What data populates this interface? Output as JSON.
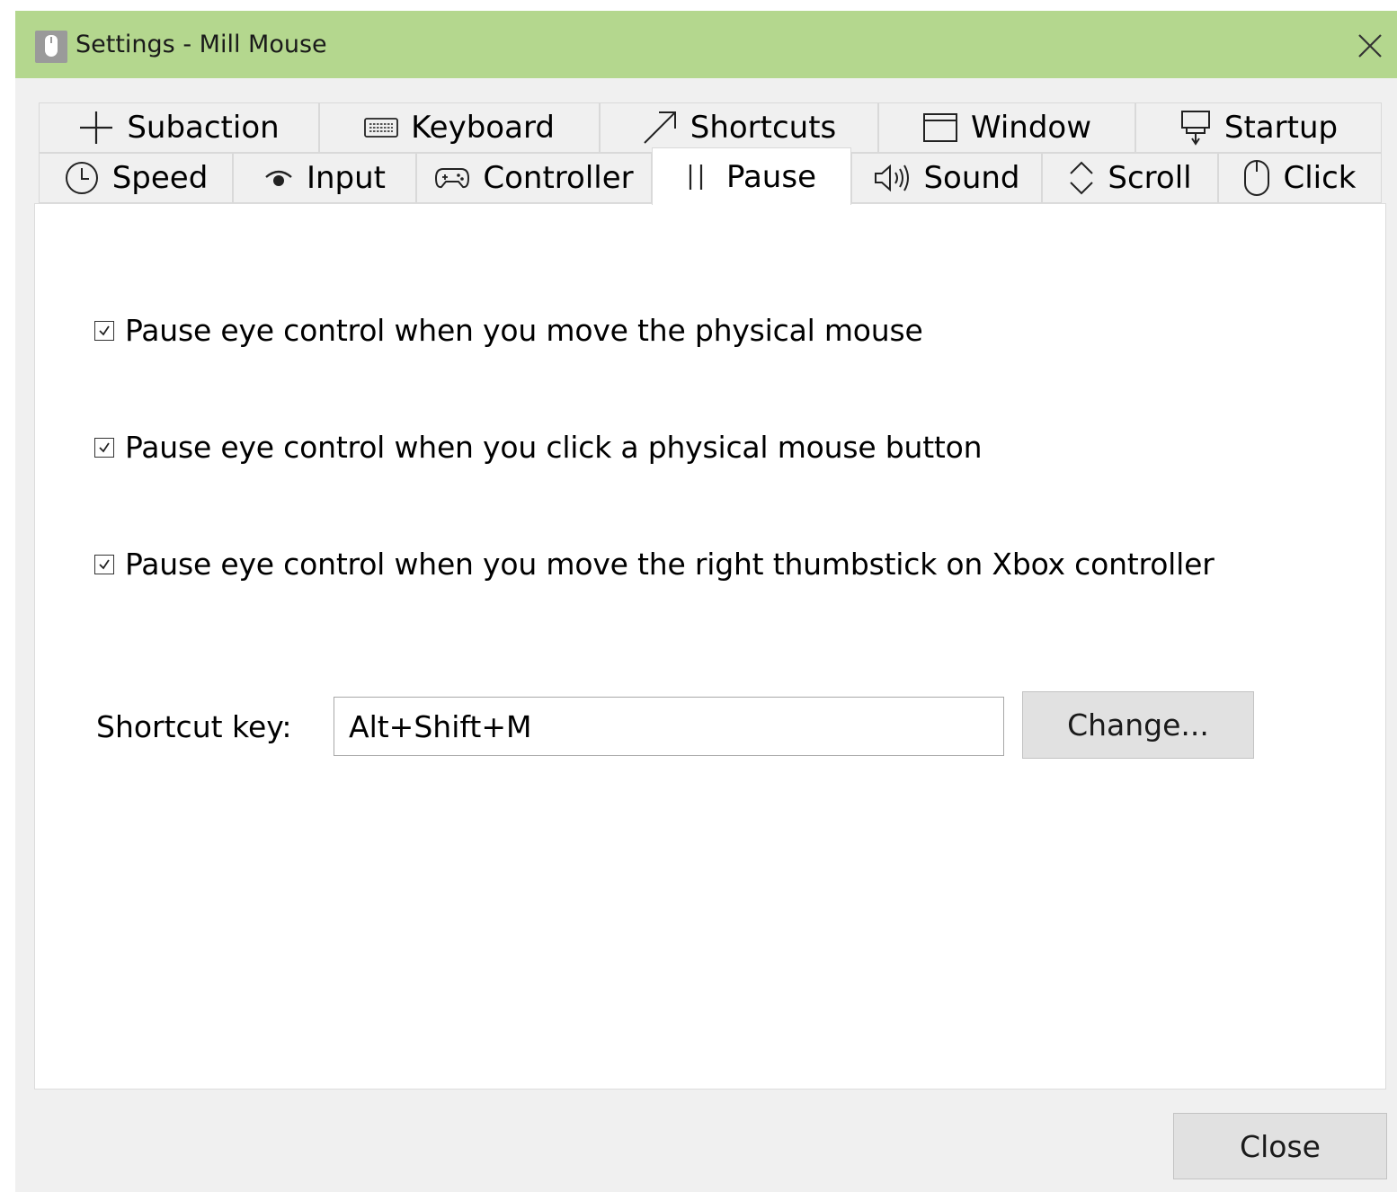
{
  "window": {
    "title": "Settings - Mill Mouse"
  },
  "tabs": {
    "row1": [
      {
        "label": "Subaction",
        "icon": "plus-icon"
      },
      {
        "label": "Keyboard",
        "icon": "keyboard-icon"
      },
      {
        "label": "Shortcuts",
        "icon": "arrow-up-right-icon"
      },
      {
        "label": "Window",
        "icon": "window-icon"
      },
      {
        "label": "Startup",
        "icon": "pin-icon"
      }
    ],
    "row2": [
      {
        "label": "Speed",
        "icon": "clock-icon"
      },
      {
        "label": "Input",
        "icon": "eye-icon"
      },
      {
        "label": "Controller",
        "icon": "gamepad-icon"
      },
      {
        "label": "Pause",
        "icon": "pause-icon",
        "selected": true
      },
      {
        "label": "Sound",
        "icon": "speaker-icon"
      },
      {
        "label": "Scroll",
        "icon": "scroll-icon"
      },
      {
        "label": "Click",
        "icon": "mouse-icon"
      }
    ]
  },
  "pause_panel": {
    "options": [
      {
        "label": "Pause eye control when you move the physical mouse",
        "checked": true
      },
      {
        "label": "Pause eye control when you click a physical mouse button",
        "checked": true
      },
      {
        "label": "Pause eye control when you move the right thumbstick on Xbox controller",
        "checked": true
      }
    ],
    "shortcut": {
      "label": "Shortcut key:",
      "value": "Alt+Shift+M",
      "change_label": "Change..."
    }
  },
  "footer": {
    "close_label": "Close"
  },
  "colors": {
    "titlebar": "#b4d78e",
    "window_bg": "#f0f0f0",
    "button_bg": "#e1e1e1"
  }
}
